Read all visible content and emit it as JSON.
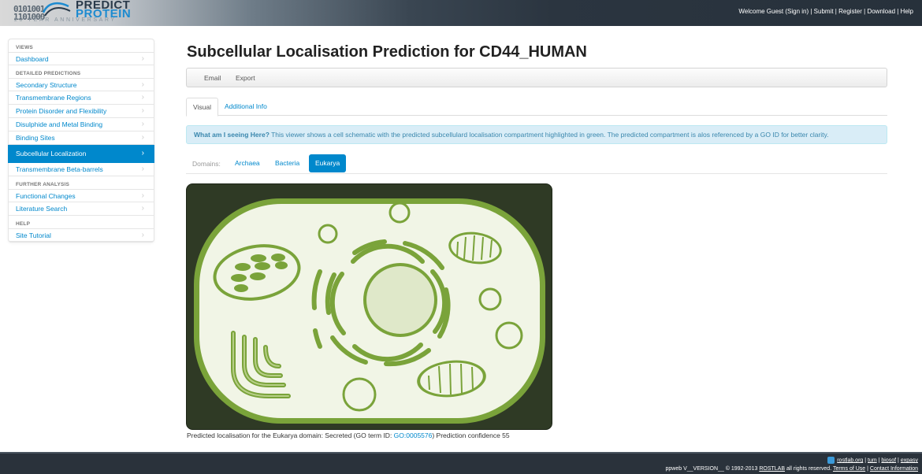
{
  "header": {
    "logo_bits_1": "0101001",
    "logo_bits_2": "1101000",
    "logo_line1": "PREDICT",
    "logo_line2": "PROTEIN",
    "logo_tagline": "20 YEAR ANNIVERSARY",
    "welcome": "Welcome Guest (Sign in)",
    "links": [
      "Submit",
      "Register",
      "Download",
      "Help"
    ]
  },
  "sidebar": {
    "sections": [
      {
        "header": "VIEWS",
        "items": [
          "Dashboard"
        ]
      },
      {
        "header": "DETAILED PREDICTIONS",
        "items": [
          "Secondary Structure",
          "Transmembrane Regions",
          "Protein Disorder and Flexibility",
          "Disulphide and Metal Binding",
          "Binding Sites",
          "Subcellular Localization",
          "Transmembrane Beta-barrels"
        ]
      },
      {
        "header": "FURTHER ANALYSIS",
        "items": [
          "Functional Changes",
          "Literature Search"
        ]
      },
      {
        "header": "HELP",
        "items": [
          "Site Tutorial"
        ]
      }
    ],
    "active_item": "Subcellular Localization"
  },
  "main": {
    "title": "Subcellular Localisation Prediction for CD44_HUMAN",
    "actions": [
      "Email",
      "Export"
    ],
    "tabs": [
      "Visual",
      "Additional Info"
    ],
    "alert_strong": "What am I seeing Here?",
    "alert_text": " This viewer shows a cell schematic with the predicted subcellulard localisation compartment highlighted in green. The predicted compartment is alos referenced by a GO ID for better clarity.",
    "domains_label": "Domains:",
    "domains": [
      "Archaea",
      "Bacteria",
      "Eukarya"
    ],
    "selected_domain": "Eukarya",
    "caption_pre": "Predicted localisation for the Eukarya domain: Secreted (GO term ID: ",
    "go_id": "GO:0005576",
    "caption_post": ") Prediction confidence 55"
  },
  "footer": {
    "links": [
      "rostlab.org",
      "tum",
      "biosof",
      "expasy"
    ],
    "version_text": "ppweb V__VERSION__ © 1992-2013 ",
    "rostlab": "ROSTLAB",
    "rights": " all rights reserved. ",
    "terms": "Terms of Use",
    "contact": "Contact Information"
  },
  "colors": {
    "accent": "#0088cc",
    "cell_background": "#2f3a25",
    "cell_green": "#7aa33a",
    "cell_fill": "#f1f5e6"
  }
}
